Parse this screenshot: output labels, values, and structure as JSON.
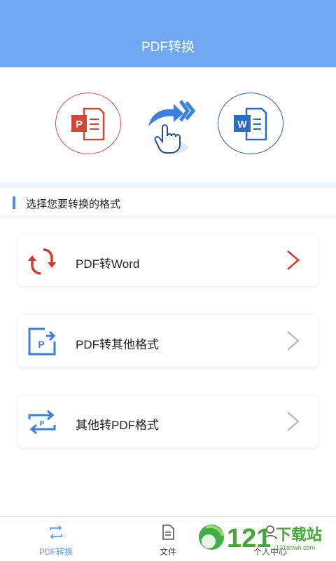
{
  "header": {
    "title": "PDF转换"
  },
  "hero": {
    "ppt_icon_letter": "P",
    "word_icon_letter": "W",
    "icons": [
      "powerpoint-icon",
      "tap-arrow-icon",
      "word-icon"
    ]
  },
  "section": {
    "title": "选择您要转换的格式"
  },
  "options": [
    {
      "label": "PDF转Word",
      "icon": "refresh-icon",
      "chevron_color": "#d33a2c"
    },
    {
      "label": "PDF转其他格式",
      "icon": "pdf-export-icon",
      "chevron_color": "#bdbdbd"
    },
    {
      "label": "其他转PDF格式",
      "icon": "pdf-swap-icon",
      "chevron_color": "#bdbdbd"
    }
  ],
  "tabs": [
    {
      "label": "PDF转换",
      "icon": "convert-icon",
      "active": true
    },
    {
      "label": "文件",
      "icon": "file-icon",
      "active": false
    },
    {
      "label": "个人中心",
      "icon": "user-icon",
      "active": false
    }
  ],
  "watermark": {
    "number": "121",
    "text": "下载站",
    "site": "121down.com"
  },
  "colors": {
    "header": "#6ea7f2",
    "accent": "#4a8ff0",
    "ppt_red": "#d14836",
    "word_blue": "#2e6bc4",
    "chevron_active": "#d33a2c",
    "chevron_idle": "#bdbdbd"
  }
}
